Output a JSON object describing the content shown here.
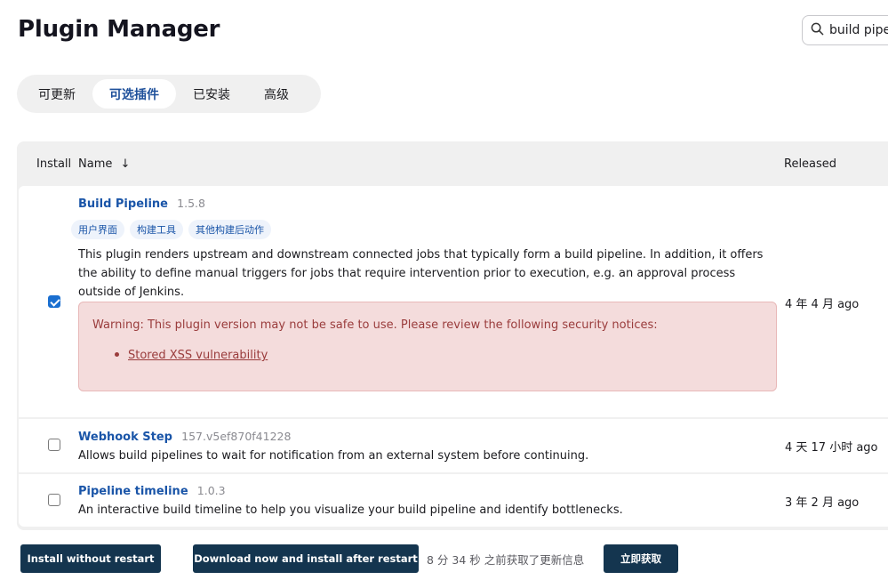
{
  "header": {
    "title": "Plugin Manager",
    "search_value": "build pipel"
  },
  "tabs": [
    {
      "label": "可更新",
      "active": false
    },
    {
      "label": "可选插件",
      "active": true
    },
    {
      "label": "已安装",
      "active": false
    },
    {
      "label": "高级",
      "active": false
    }
  ],
  "table": {
    "headers": {
      "install": "Install",
      "name": "Name",
      "sort_indicator": "↓",
      "released": "Released"
    },
    "rows": [
      {
        "name": "Build Pipeline",
        "version": "1.5.8",
        "checked": true,
        "tags": [
          "用户界面",
          "构建工具",
          "其他构建后动作"
        ],
        "description": "This plugin renders upstream and downstream connected jobs that typically form a build pipeline. In addition, it offers the ability to define manual triggers for jobs that require intervention prior to execution, e.g. an approval process outside of Jenkins.",
        "warning": {
          "text": "Warning: This plugin version may not be safe to use. Please review the following security notices:",
          "link": "Stored XSS vulnerability"
        },
        "released": "4 年 4 月 ago"
      },
      {
        "name": "Webhook Step",
        "version": "157.v5ef870f41228",
        "checked": false,
        "description": "Allows build pipelines to wait for notification from an external system before continuing.",
        "released": "4 天 17 小时 ago"
      },
      {
        "name": "Pipeline timeline",
        "version": "1.0.3",
        "checked": false,
        "description": "An interactive build timeline to help you visualize your build pipeline and identify bottlenecks.",
        "released": "3 年 2 月 ago"
      }
    ]
  },
  "footer": {
    "install_without_restart": "Install without restart",
    "download_install_after_restart": "Download now and install after restart",
    "update_info": "8 分 34 秒 之前获取了更新信息",
    "fetch_now": "立即获取"
  },
  "colors": {
    "accent_link": "#1a55a8",
    "primary_button": "#14354f",
    "warning_bg": "#f4dcdc",
    "warning_text": "#9a3c3c",
    "checkbox_checked": "#1a6fd0"
  },
  "icons": {
    "search": "search-icon"
  }
}
